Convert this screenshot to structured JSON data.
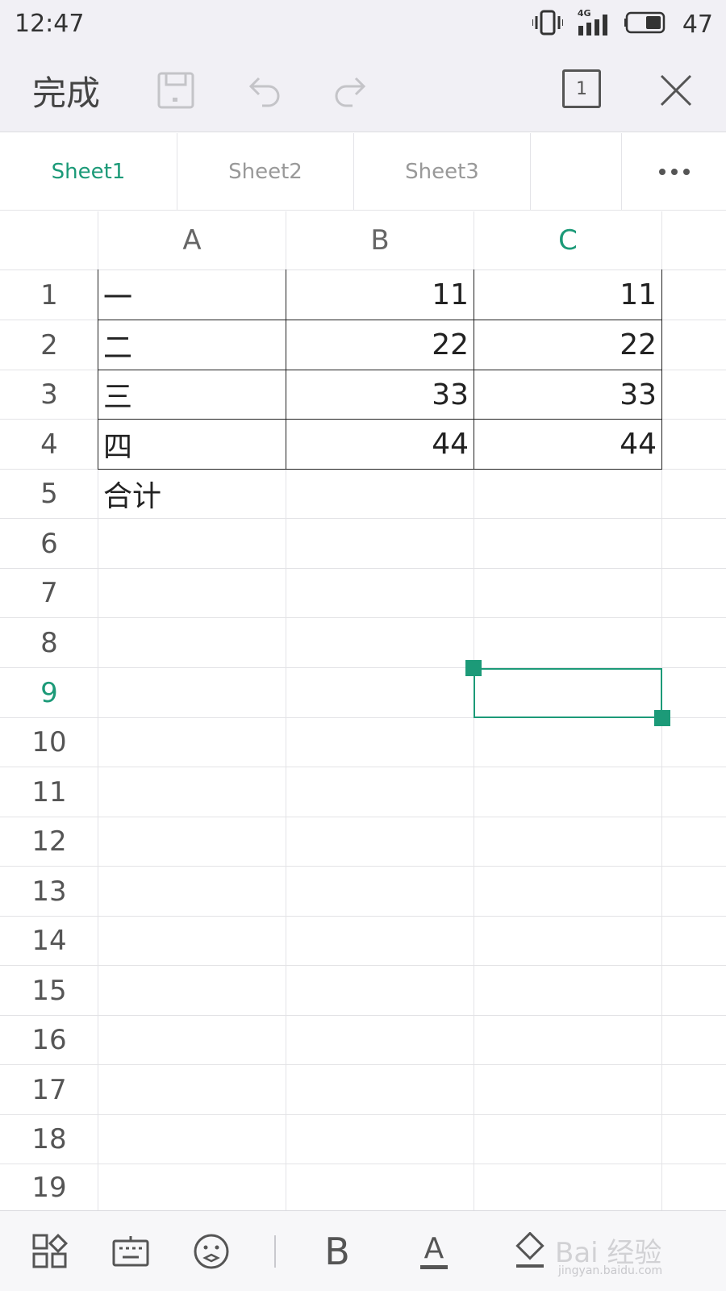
{
  "status_bar": {
    "time": "12:47",
    "network": "4G",
    "battery": "47"
  },
  "toolbar": {
    "done_label": "完成",
    "sheet_count": "1"
  },
  "tabs": [
    {
      "label": "Sheet1",
      "active": true
    },
    {
      "label": "Sheet2",
      "active": false
    },
    {
      "label": "Sheet3",
      "active": false
    }
  ],
  "columns": [
    "A",
    "B",
    "C"
  ],
  "rows": [
    "1",
    "2",
    "3",
    "4",
    "5",
    "6",
    "7",
    "8",
    "9",
    "10",
    "11",
    "12",
    "13",
    "14",
    "15",
    "16",
    "17",
    "18",
    "19"
  ],
  "selected_cell": "C9",
  "cells": {
    "A1": "一",
    "B1": "11",
    "C1": "11",
    "A2": "二",
    "B2": "22",
    "C2": "22",
    "A3": "三",
    "B3": "33",
    "C3": "33",
    "A4": "四",
    "B4": "44",
    "C4": "44",
    "A5": "合计",
    "B5": "",
    "C5": ""
  },
  "bottom_bar": {
    "bold_label": "B",
    "font_color_label": "A",
    "watermark": "Bai 经验",
    "watermark_url": "jingyan.baidu.com"
  },
  "colors": {
    "accent": "#1c9a78",
    "toolbar_bg": "#f1f0f5",
    "grid_line": "#e3e3e6"
  }
}
